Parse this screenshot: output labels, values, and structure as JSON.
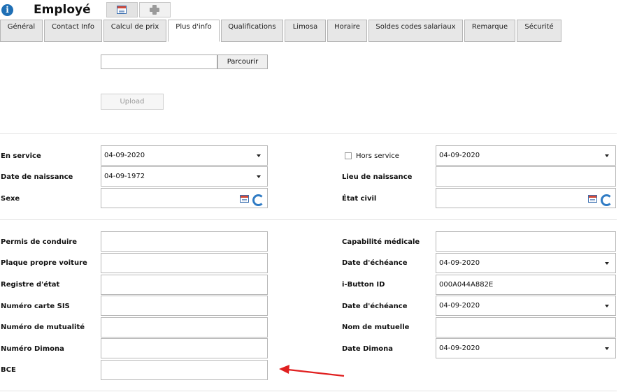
{
  "header": {
    "title": "Employé",
    "icons": [
      "info-icon",
      "calendar-icon",
      "plus-icon"
    ]
  },
  "tabs": [
    {
      "label": "Général"
    },
    {
      "label": "Contact Info"
    },
    {
      "label": "Calcul de prix"
    },
    {
      "label": "Plus d'info",
      "active": true
    },
    {
      "label": "Qualifications"
    },
    {
      "label": "Limosa"
    },
    {
      "label": "Horaire"
    },
    {
      "label": "Soldes codes salariaux"
    },
    {
      "label": "Remarque"
    },
    {
      "label": "Sécurité"
    }
  ],
  "upload": {
    "file_value": "",
    "browse_label": "Parcourir",
    "upload_label": "Upload"
  },
  "fields": {
    "en_service": {
      "label": "En service",
      "value": "04-09-2020"
    },
    "hors_service": {
      "label": "Hors service",
      "checked": false,
      "value": "04-09-2020"
    },
    "date_naissance": {
      "label": "Date de naissance",
      "value": "04-09-1972"
    },
    "lieu_naissance": {
      "label": "Lieu de naissance",
      "value": ""
    },
    "sexe": {
      "label": "Sexe",
      "value": ""
    },
    "etat_civil": {
      "label": "État civil",
      "value": ""
    },
    "permis": {
      "label": "Permis de conduire",
      "value": ""
    },
    "capabilite": {
      "label": "Capabilité médicale",
      "value": ""
    },
    "plaque": {
      "label": "Plaque propre voiture",
      "value": ""
    },
    "echeance1": {
      "label": "Date d'échéance",
      "value": "04-09-2020"
    },
    "registre": {
      "label": "Registre d'état",
      "value": ""
    },
    "ibutton": {
      "label": "i-Button ID",
      "value": "000A044A882E"
    },
    "sis": {
      "label": "Numéro carte SIS",
      "value": ""
    },
    "echeance2": {
      "label": "Date d'échéance",
      "value": "04-09-2020"
    },
    "mutualite": {
      "label": "Numéro de mutualité",
      "value": ""
    },
    "mutuelle": {
      "label": "Nom de mutuelle",
      "value": ""
    },
    "dimona_num": {
      "label": "Numéro Dimona",
      "value": ""
    },
    "dimona_date": {
      "label": "Date Dimona",
      "value": "04-09-2020"
    },
    "bce": {
      "label": "BCE",
      "value": ""
    }
  },
  "colors": {
    "accent": "#1f6fb5",
    "annotation_arrow": "#e02020"
  }
}
